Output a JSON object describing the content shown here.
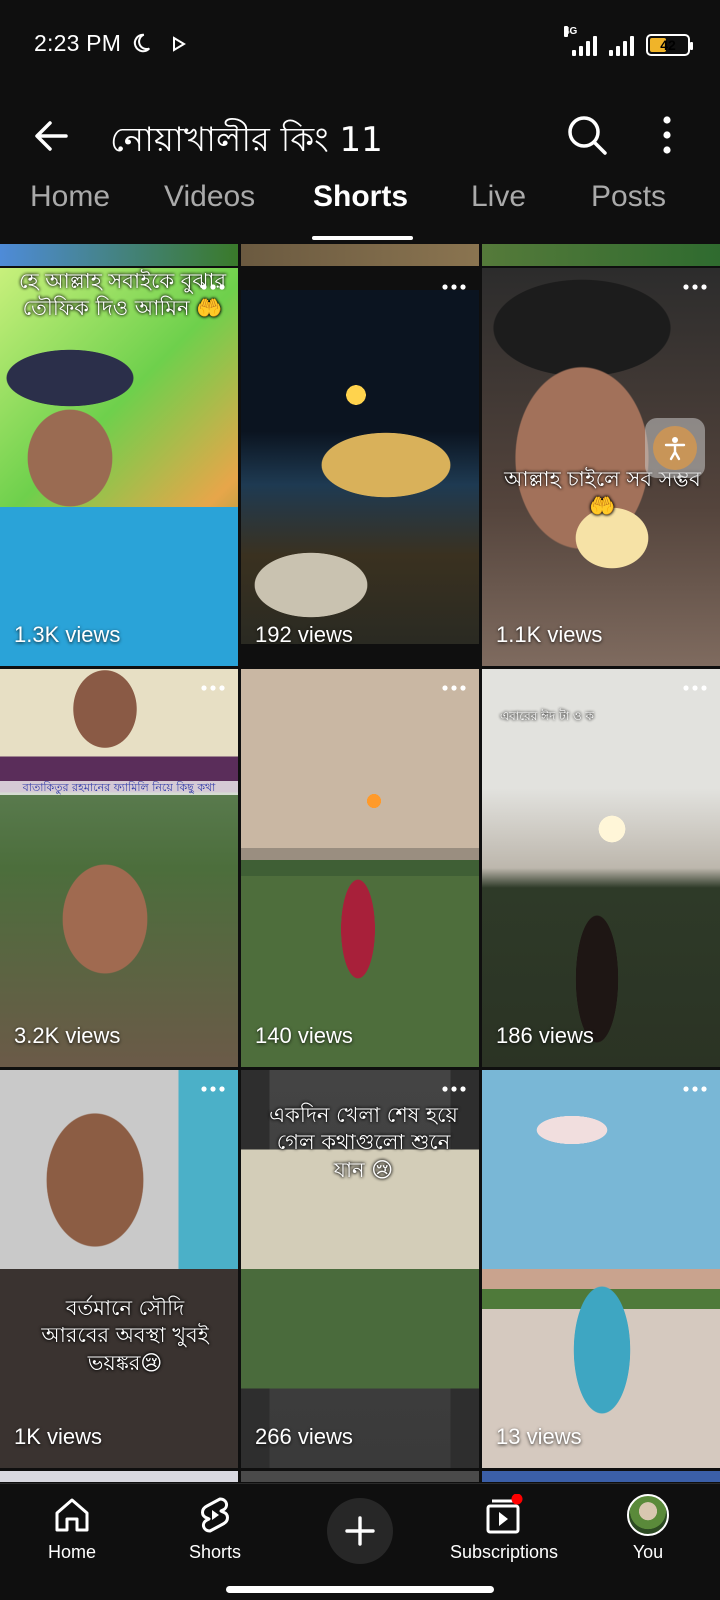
{
  "status_bar": {
    "time": "2:23 PM",
    "network_label": "4G",
    "battery_level": "42"
  },
  "app_bar": {
    "title": "নোয়াখালীর কিং 11"
  },
  "tabs": [
    {
      "label": "Home",
      "active": false
    },
    {
      "label": "Videos",
      "active": false
    },
    {
      "label": "Shorts",
      "active": true
    },
    {
      "label": "Live",
      "active": false
    },
    {
      "label": "Posts",
      "active": false
    }
  ],
  "shorts": [
    {
      "views": "1.3K views",
      "caption": "হে আল্লাহ সবাইকে বুঝার তৌফিক দিও আমিন 🤲"
    },
    {
      "views": "192 views",
      "caption": ""
    },
    {
      "views": "1.1K views",
      "caption": "আল্লাহ চাইলে সব সম্ভব 🤲"
    },
    {
      "views": "3.2K views",
      "caption": "বাতাকিতুর রহমানের ফ্যামিলি নিয়ে কিছু কথা"
    },
    {
      "views": "140 views",
      "caption": ""
    },
    {
      "views": "186 views",
      "caption": "এবারের ঈদ টা ও ক"
    },
    {
      "views": "1K views",
      "caption": "বর্তমানে সৌদি আরবের অবস্থা খুবই ভয়ঙ্কর😢"
    },
    {
      "views": "266 views",
      "caption": "একদিন খেলা শেষ হয়ে গেল কথাগুলো শুনে যান 😢"
    },
    {
      "views": "13 views",
      "caption": ""
    }
  ],
  "bottom_nav": {
    "home": "Home",
    "shorts": "Shorts",
    "subscriptions": "Subscriptions",
    "you": "You"
  },
  "colors": {
    "background": "#0f0f0f",
    "notification_dot": "#ff0000",
    "battery_fill": "#f0b429"
  }
}
